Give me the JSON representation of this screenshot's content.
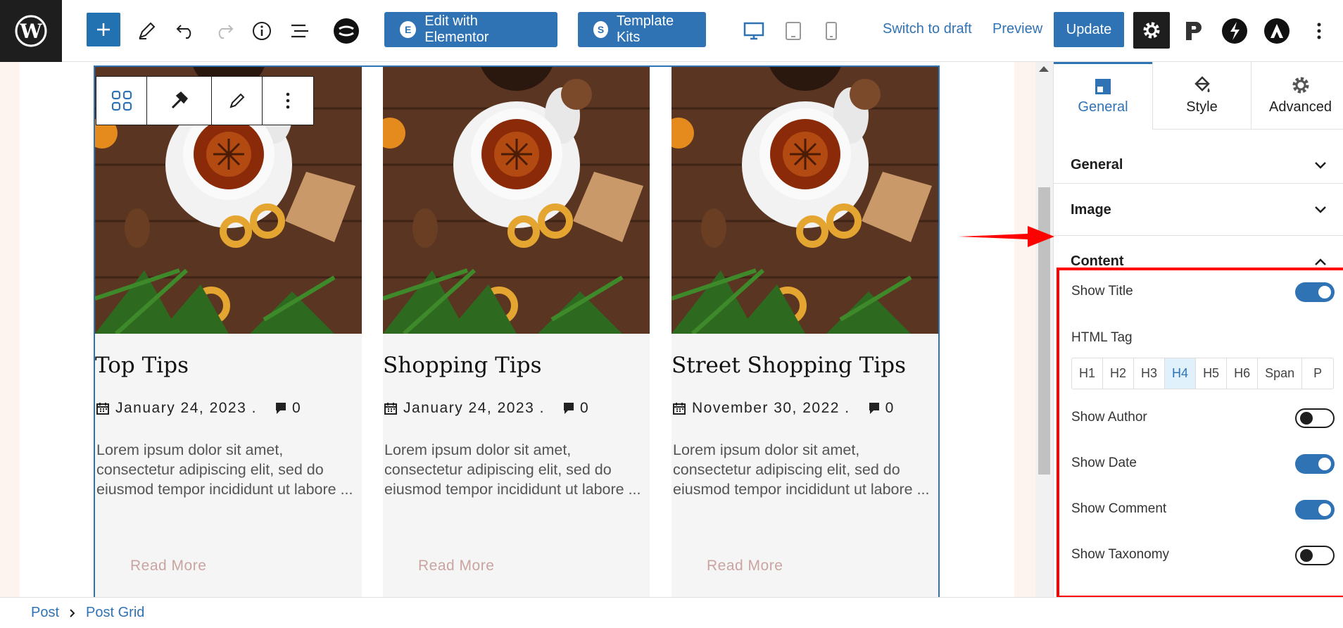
{
  "toolbar": {
    "edit_elementor": "Edit with Elementor",
    "template_kits": "Template Kits",
    "switch_to_draft": "Switch to draft",
    "preview": "Preview",
    "update": "Update"
  },
  "cards": [
    {
      "title": "Top Tips",
      "date": "January 24, 2023 .",
      "comments": "0",
      "excerpt": "Lorem ipsum dolor sit amet, consectetur adipiscing elit, sed do eiusmod tempor incididunt ut labore ...",
      "read_more": "Read More"
    },
    {
      "title": "Shopping Tips",
      "date": "January 24, 2023 .",
      "comments": "0",
      "excerpt": "Lorem ipsum dolor sit amet, consectetur adipiscing elit, sed do eiusmod tempor incididunt ut labore ...",
      "read_more": "Read More"
    },
    {
      "title": "Street Shopping Tips",
      "date": "November 30, 2022 .",
      "comments": "0",
      "excerpt": "Lorem ipsum dolor sit amet, consectetur adipiscing elit, sed do eiusmod tempor incididunt ut labore ...",
      "read_more": "Read More"
    }
  ],
  "sidebar": {
    "tabs": [
      {
        "label": "General",
        "icon": "square-layout-icon",
        "active": true
      },
      {
        "label": "Style",
        "icon": "paint-bucket-icon",
        "active": false
      },
      {
        "label": "Advanced",
        "icon": "gear-icon",
        "active": false
      }
    ],
    "panels": {
      "general": "General",
      "image": "Image",
      "content": "Content"
    },
    "options": {
      "show_title": {
        "label": "Show Title",
        "on": true
      },
      "html_tag_label": "HTML Tag",
      "html_tags": [
        "H1",
        "H2",
        "H3",
        "H4",
        "H5",
        "H6",
        "Span",
        "P"
      ],
      "html_tag_selected": "H4",
      "show_author": {
        "label": "Show Author",
        "on": false
      },
      "show_date": {
        "label": "Show Date",
        "on": true
      },
      "show_comment": {
        "label": "Show Comment",
        "on": true
      },
      "show_taxonomy": {
        "label": "Show Taxonomy",
        "on": false
      }
    }
  },
  "breadcrumb": {
    "root": "Post",
    "current": "Post Grid"
  },
  "colors": {
    "accent": "#2f73b5",
    "highlight": "#ff0000"
  }
}
